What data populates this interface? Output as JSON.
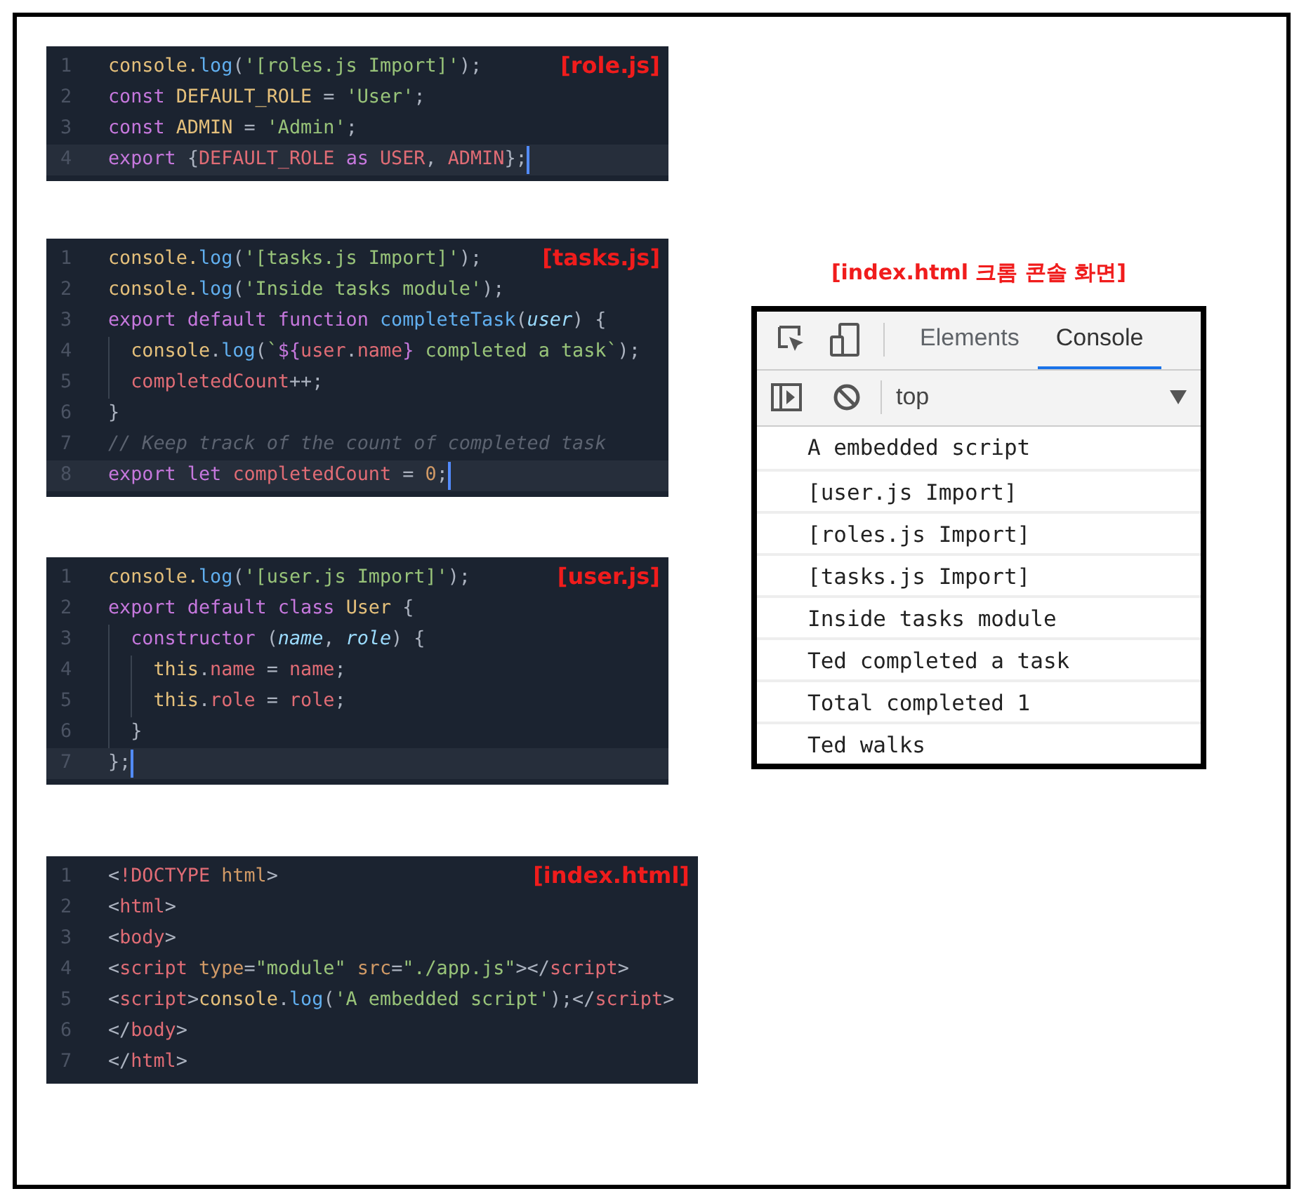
{
  "files": [
    {
      "label": "[role.js]",
      "lines": [
        {
          "number": "1",
          "active": false,
          "tokens": [
            {
              "kind": "object",
              "text": "console."
            },
            {
              "kind": "function",
              "text": "log"
            },
            {
              "kind": "punct",
              "text": "("
            },
            {
              "kind": "string",
              "text": "'[roles.js Import]'"
            },
            {
              "kind": "punct",
              "text": ");"
            }
          ]
        },
        {
          "number": "2",
          "active": false,
          "tokens": [
            {
              "kind": "keyword",
              "text": "const "
            },
            {
              "kind": "object",
              "text": "DEFAULT_ROLE"
            },
            {
              "kind": "punct",
              "text": " = "
            },
            {
              "kind": "string",
              "text": "'User'"
            },
            {
              "kind": "punct",
              "text": ";"
            }
          ]
        },
        {
          "number": "3",
          "active": false,
          "tokens": [
            {
              "kind": "keyword",
              "text": "const "
            },
            {
              "kind": "object",
              "text": "ADMIN"
            },
            {
              "kind": "punct",
              "text": " = "
            },
            {
              "kind": "string",
              "text": "'Admin'"
            },
            {
              "kind": "punct",
              "text": ";"
            }
          ]
        },
        {
          "number": "4",
          "active": true,
          "tokens": [
            {
              "kind": "keyword",
              "text": "export "
            },
            {
              "kind": "punct",
              "text": "{"
            },
            {
              "kind": "variable",
              "text": "DEFAULT_ROLE "
            },
            {
              "kind": "keyword",
              "text": "as "
            },
            {
              "kind": "variable",
              "text": "USER"
            },
            {
              "kind": "punct",
              "text": ", "
            },
            {
              "kind": "variable",
              "text": "ADMIN"
            },
            {
              "kind": "punct",
              "text": "};"
            }
          ]
        }
      ]
    },
    {
      "label": "[tasks.js]",
      "lines": [
        {
          "number": "1",
          "active": false,
          "tokens": [
            {
              "kind": "object",
              "text": "console."
            },
            {
              "kind": "function",
              "text": "log"
            },
            {
              "kind": "punct",
              "text": "("
            },
            {
              "kind": "string",
              "text": "'[tasks.js Import]'"
            },
            {
              "kind": "punct",
              "text": ");"
            }
          ]
        },
        {
          "number": "2",
          "active": false,
          "tokens": [
            {
              "kind": "object",
              "text": "console."
            },
            {
              "kind": "function",
              "text": "log"
            },
            {
              "kind": "punct",
              "text": "("
            },
            {
              "kind": "string",
              "text": "'Inside tasks module'"
            },
            {
              "kind": "punct",
              "text": ");"
            }
          ]
        },
        {
          "number": "3",
          "active": false,
          "tokens": [
            {
              "kind": "keyword",
              "text": "export default function "
            },
            {
              "kind": "function",
              "text": "completeTask"
            },
            {
              "kind": "punct",
              "text": "("
            },
            {
              "kind": "param",
              "text": "user"
            },
            {
              "kind": "punct",
              "text": ") {"
            }
          ]
        },
        {
          "number": "4",
          "active": false,
          "tokens": [
            {
              "kind": "object",
              "text": "  console"
            },
            {
              "kind": "punct",
              "text": "."
            },
            {
              "kind": "function",
              "text": "log"
            },
            {
              "kind": "punct",
              "text": "("
            },
            {
              "kind": "string",
              "text": "`"
            },
            {
              "kind": "keyword",
              "text": "${"
            },
            {
              "kind": "variable",
              "text": "user"
            },
            {
              "kind": "punct",
              "text": "."
            },
            {
              "kind": "variable",
              "text": "name"
            },
            {
              "kind": "keyword",
              "text": "}"
            },
            {
              "kind": "string",
              "text": " completed a task`"
            },
            {
              "kind": "punct",
              "text": ");"
            }
          ]
        },
        {
          "number": "5",
          "active": false,
          "tokens": [
            {
              "kind": "variable",
              "text": "  completedCount"
            },
            {
              "kind": "punct",
              "text": "++;"
            }
          ]
        },
        {
          "number": "6",
          "active": false,
          "tokens": [
            {
              "kind": "punct",
              "text": "}"
            }
          ]
        },
        {
          "number": "7",
          "active": false,
          "tokens": [
            {
              "kind": "comment",
              "text": "// Keep track of the count of completed task"
            }
          ]
        },
        {
          "number": "8",
          "active": true,
          "tokens": [
            {
              "kind": "keyword",
              "text": "export let "
            },
            {
              "kind": "variable",
              "text": "completedCount"
            },
            {
              "kind": "punct",
              "text": " = "
            },
            {
              "kind": "number",
              "text": "0"
            },
            {
              "kind": "punct",
              "text": ";"
            }
          ]
        }
      ]
    },
    {
      "label": "[user.js]",
      "lines": [
        {
          "number": "1",
          "active": false,
          "tokens": [
            {
              "kind": "object",
              "text": "console."
            },
            {
              "kind": "function",
              "text": "log"
            },
            {
              "kind": "punct",
              "text": "("
            },
            {
              "kind": "string",
              "text": "'[user.js Import]'"
            },
            {
              "kind": "punct",
              "text": ");"
            }
          ]
        },
        {
          "number": "2",
          "active": false,
          "tokens": [
            {
              "kind": "keyword",
              "text": "export default class "
            },
            {
              "kind": "object",
              "text": "User"
            },
            {
              "kind": "punct",
              "text": " {"
            }
          ]
        },
        {
          "number": "3",
          "active": false,
          "tokens": [
            {
              "kind": "keyword",
              "text": "  constructor "
            },
            {
              "kind": "punct",
              "text": "("
            },
            {
              "kind": "param",
              "text": "name"
            },
            {
              "kind": "punct",
              "text": ", "
            },
            {
              "kind": "param",
              "text": "role"
            },
            {
              "kind": "punct",
              "text": ") {"
            }
          ]
        },
        {
          "number": "4",
          "active": false,
          "tokens": [
            {
              "kind": "object",
              "text": "    this"
            },
            {
              "kind": "punct",
              "text": "."
            },
            {
              "kind": "variable",
              "text": "name"
            },
            {
              "kind": "punct",
              "text": " = "
            },
            {
              "kind": "variable",
              "text": "name"
            },
            {
              "kind": "punct",
              "text": ";"
            }
          ]
        },
        {
          "number": "5",
          "active": false,
          "tokens": [
            {
              "kind": "object",
              "text": "    this"
            },
            {
              "kind": "punct",
              "text": "."
            },
            {
              "kind": "variable",
              "text": "role"
            },
            {
              "kind": "punct",
              "text": " = "
            },
            {
              "kind": "variable",
              "text": "role"
            },
            {
              "kind": "punct",
              "text": ";"
            }
          ]
        },
        {
          "number": "6",
          "active": false,
          "tokens": [
            {
              "kind": "punct",
              "text": "  }"
            }
          ]
        },
        {
          "number": "7",
          "active": true,
          "tokens": [
            {
              "kind": "punct",
              "text": "};"
            }
          ]
        }
      ]
    },
    {
      "label": "[index.html]",
      "lines": [
        {
          "number": "1",
          "active": false,
          "tokens": [
            {
              "kind": "punct",
              "text": "<"
            },
            {
              "kind": "tag",
              "text": "!DOCTYPE"
            },
            {
              "kind": "attr",
              "text": " html"
            },
            {
              "kind": "punct",
              "text": ">"
            }
          ]
        },
        {
          "number": "2",
          "active": false,
          "tokens": [
            {
              "kind": "punct",
              "text": "<"
            },
            {
              "kind": "tag",
              "text": "html"
            },
            {
              "kind": "punct",
              "text": ">"
            }
          ]
        },
        {
          "number": "3",
          "active": false,
          "tokens": [
            {
              "kind": "punct",
              "text": "<"
            },
            {
              "kind": "tag",
              "text": "body"
            },
            {
              "kind": "punct",
              "text": ">"
            }
          ]
        },
        {
          "number": "4",
          "active": false,
          "tokens": [
            {
              "kind": "punct",
              "text": "<"
            },
            {
              "kind": "tag",
              "text": "script"
            },
            {
              "kind": "attr",
              "text": " type"
            },
            {
              "kind": "punct",
              "text": "="
            },
            {
              "kind": "string",
              "text": "\"module\""
            },
            {
              "kind": "attr",
              "text": " src"
            },
            {
              "kind": "punct",
              "text": "="
            },
            {
              "kind": "string",
              "text": "\"./app.js\""
            },
            {
              "kind": "punct",
              "text": "></"
            },
            {
              "kind": "tag",
              "text": "script"
            },
            {
              "kind": "punct",
              "text": ">"
            }
          ]
        },
        {
          "number": "5",
          "active": false,
          "tokens": [
            {
              "kind": "punct",
              "text": "<"
            },
            {
              "kind": "tag",
              "text": "script"
            },
            {
              "kind": "punct",
              "text": ">"
            },
            {
              "kind": "object",
              "text": "console"
            },
            {
              "kind": "punct",
              "text": "."
            },
            {
              "kind": "function",
              "text": "log"
            },
            {
              "kind": "punct",
              "text": "("
            },
            {
              "kind": "string",
              "text": "'A embedded script'"
            },
            {
              "kind": "punct",
              "text": ");</"
            },
            {
              "kind": "tag",
              "text": "script"
            },
            {
              "kind": "punct",
              "text": ">"
            }
          ]
        },
        {
          "number": "6",
          "active": false,
          "tokens": [
            {
              "kind": "punct",
              "text": "</"
            },
            {
              "kind": "tag",
              "text": "body"
            },
            {
              "kind": "punct",
              "text": ">"
            }
          ]
        },
        {
          "number": "7",
          "active": false,
          "tokens": [
            {
              "kind": "punct",
              "text": "</"
            },
            {
              "kind": "tag",
              "text": "html"
            },
            {
              "kind": "punct",
              "text": ">"
            }
          ]
        }
      ]
    }
  ],
  "console": {
    "title": "[index.html 크롬 콘솔 화면]",
    "tabs": [
      {
        "label": "Elements",
        "selected": false
      },
      {
        "label": "Console",
        "selected": true
      }
    ],
    "context": "top",
    "messages": [
      "A embedded script",
      "[user.js Import]",
      "[roles.js Import]",
      "[tasks.js Import]",
      "Inside tasks module",
      "Ted completed a task",
      "Total completed 1",
      "Ted walks"
    ]
  }
}
